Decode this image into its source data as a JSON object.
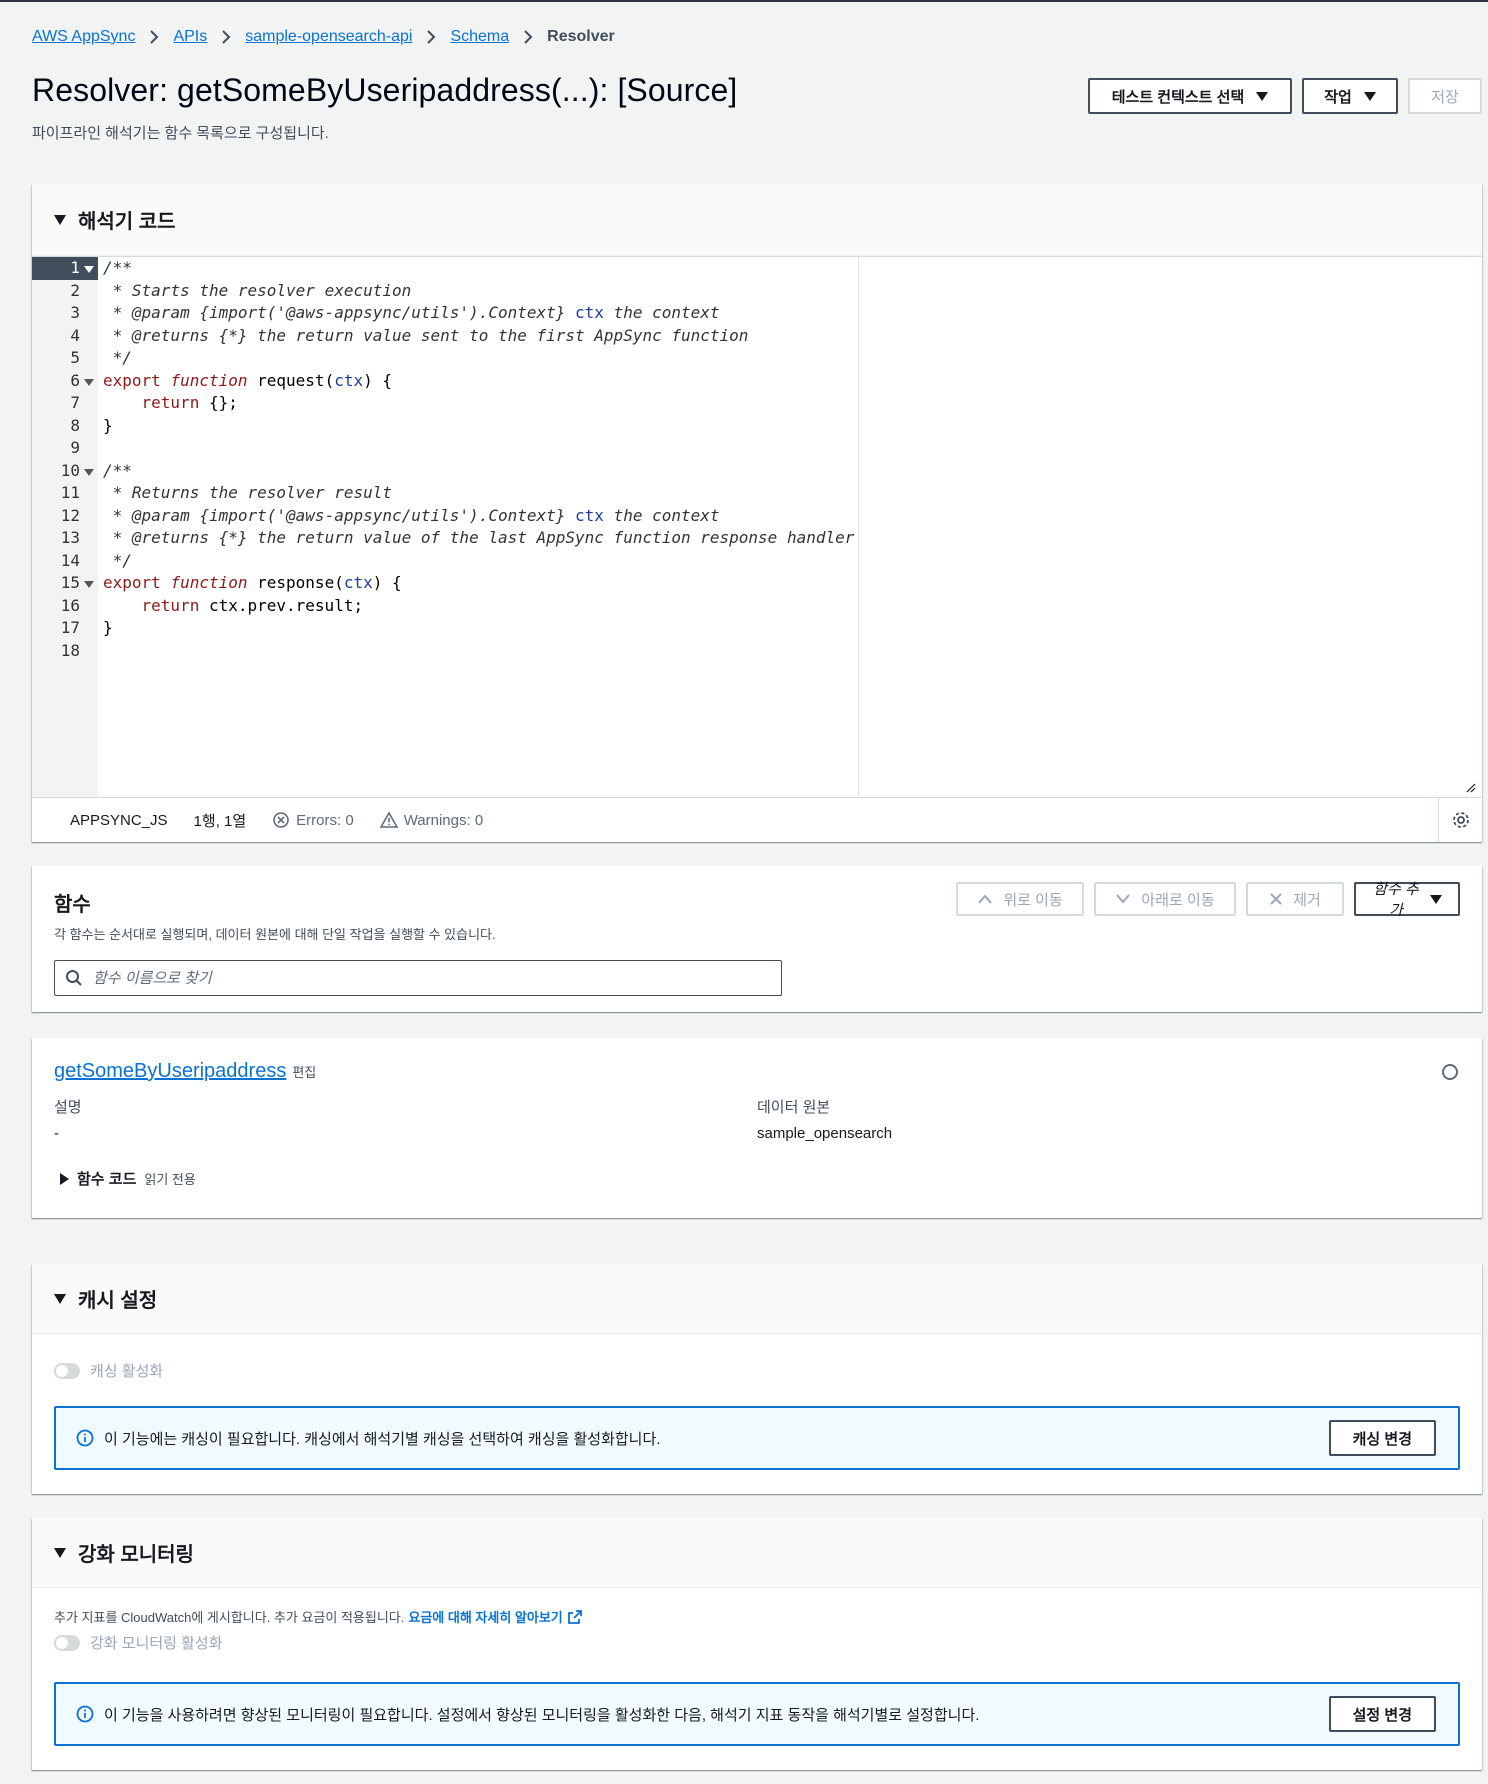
{
  "breadcrumb": {
    "items": [
      "AWS AppSync",
      "APIs",
      "sample-opensearch-api",
      "Schema"
    ],
    "current": "Resolver"
  },
  "header": {
    "title": "Resolver: getSomeByUseripaddress(...): [Source]",
    "description": "파이프라인 해석기는 함수 목록으로 구성됩니다.",
    "test_context_button": "테스트 컨텍스트 선택",
    "actions_button": "작업",
    "save_button": "저장"
  },
  "resolver_code": {
    "heading": "해석기 코드",
    "lines": [
      "/**",
      " * Starts the resolver execution",
      " * @param {import('@aws-appsync/utils').Context} ctx the context",
      " * @returns {*} the return value sent to the first AppSync function",
      " */",
      "export function request(ctx) {",
      "    return {};",
      "}",
      "",
      "/**",
      " * Returns the resolver result",
      " * @param {import('@aws-appsync/utils').Context} ctx the context",
      " * @returns {*} the return value of the last AppSync function response handler",
      " */",
      "export function response(ctx) {",
      "    return ctx.prev.result;",
      "}",
      ""
    ],
    "status": {
      "runtime": "APPSYNC_JS",
      "position": "1행, 1열",
      "errors": "Errors: 0",
      "warnings": "Warnings: 0"
    }
  },
  "functions": {
    "heading": "함수",
    "description": "각 함수는 순서대로 실행되며, 데이터 원본에 대해 단일 작업을 실행할 수 있습니다.",
    "move_up": "위로 이동",
    "move_down": "아래로 이동",
    "remove": "제거",
    "add_function": "함수 추가",
    "search_placeholder": "함수 이름으로 찾기"
  },
  "function_card": {
    "name": "getSomeByUseripaddress",
    "edit": "편집",
    "description_label": "설명",
    "description_value": "-",
    "datasource_label": "데이터 원본",
    "datasource_value": "sample_opensearch",
    "code_expander": "함수 코드",
    "code_readonly": "읽기 전용"
  },
  "cache": {
    "heading": "캐시 설정",
    "toggle_label": "캐싱 활성화",
    "alert_text": "이 기능에는 캐싱이 필요합니다. 캐싱에서 해석기별 캐싱을 선택하여 캐싱을 활성화합니다.",
    "alert_button": "캐싱 변경"
  },
  "monitoring": {
    "heading": "강화 모니터링",
    "note": "추가 지표를 CloudWatch에 게시합니다. 추가 요금이 적용됩니다.",
    "link": "요금에 대해 자세히 알아보기",
    "toggle_label": "강화 모니터링 활성화",
    "alert_text": "이 기능을 사용하려면 향상된 모니터링이 필요합니다. 설정에서 향상된 모니터링을 활성화한 다음, 해석기 지표 동작을 해석기별로 설정합니다.",
    "alert_button": "설정 변경"
  },
  "colors": {
    "link": "#0972d3",
    "background": "#f2f3f3",
    "active_gutter": "#404d5b",
    "alert_border": "#0972d3"
  }
}
